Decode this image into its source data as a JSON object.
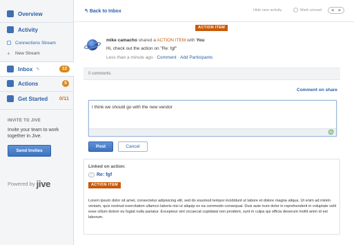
{
  "sidebar": {
    "items": [
      {
        "label": "Overview",
        "icon": "overview-icon"
      },
      {
        "label": "Activity",
        "icon": "activity-icon"
      },
      {
        "label": "Connections Stream"
      },
      {
        "label": "New Stream"
      },
      {
        "label": "Inbox",
        "badge": "12",
        "icon": "inbox-icon"
      },
      {
        "label": "Actions",
        "badge": "5",
        "icon": "actions-icon"
      },
      {
        "label": "Get Started",
        "count": "0/11",
        "icon": "get-started-icon"
      }
    ],
    "invite": {
      "heading": "INVITE TO JIVE",
      "text": "Invite your team to work together in Jive.",
      "button": "Send Invites"
    },
    "powered_by": "Powered by",
    "brand": "jive"
  },
  "topbar": {
    "back": "Back to Inbox",
    "hide_new": "Hide new activity",
    "mark_unread": "Mark unread"
  },
  "post": {
    "tag": "ACTION ITEM",
    "user": "mike camacho",
    "action_text": "shared a",
    "action_item": "ACTION ITEM",
    "with_text": "with",
    "with_user": "You",
    "message": "Hi, check out the action on \"Re: fgf\"",
    "time": "Less than a minute ago",
    "comment_link": "Comment",
    "add_participants": "Add Participants"
  },
  "comments": {
    "count": "0 comments",
    "comment_on_share": "Comment on share",
    "input_value": "I think we should go with the new vendor",
    "post_button": "Post",
    "cancel_button": "Cancel"
  },
  "linked": {
    "heading": "Linked on action:",
    "title": "Re: fgf",
    "tag": "ACTION ITEM",
    "body": "Lorem ipsum dolor sit amet, consectetur adipisicing elit, sed do eiusmod tempor incididunt ut labore et dolore magna aliqua. Ut enim ad minim veniam, quis nostrud exercitation ullamco laboris nisi ut aliquip ex ea commodo consequat. Duis aute irure dolor in reprehenderit in voluptate velit esse cillum dolore eu fugiat nulla pariatur. Excepteur sint occaecat cupidatat non proident, sunt in culpa qui officia deserunt mollit anim id est laborum."
  },
  "colors": {
    "accent": "#2a5ea8",
    "action_tag": "#c85a0a",
    "badge_orange": "#d9891e"
  }
}
